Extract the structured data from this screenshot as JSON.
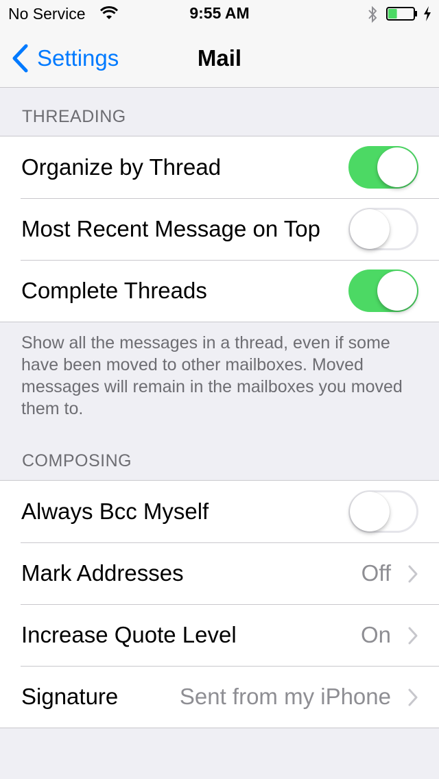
{
  "status_bar": {
    "carrier": "No Service",
    "time": "9:55 AM",
    "battery_level": 0.35,
    "battery_color": "#4cd964"
  },
  "nav": {
    "back_label": "Settings",
    "title": "Mail"
  },
  "threading": {
    "header": "THREADING",
    "rows": [
      {
        "label": "Organize by Thread",
        "toggle": true
      },
      {
        "label": "Most Recent Message on Top",
        "toggle": false
      },
      {
        "label": "Complete Threads",
        "toggle": true
      }
    ],
    "footer": "Show all the messages in a thread, even if some have been moved to other mailboxes. Moved messages will remain in the mailboxes you moved them to."
  },
  "composing": {
    "header": "COMPOSING",
    "rows": [
      {
        "label": "Always Bcc Myself",
        "toggle": false
      },
      {
        "label": "Mark Addresses",
        "value": "Off"
      },
      {
        "label": "Increase Quote Level",
        "value": "On"
      },
      {
        "label": "Signature",
        "value": "Sent from my iPhone"
      }
    ]
  },
  "colors": {
    "accent": "#007aff",
    "toggle_on": "#4cd964",
    "background": "#efeff4"
  }
}
